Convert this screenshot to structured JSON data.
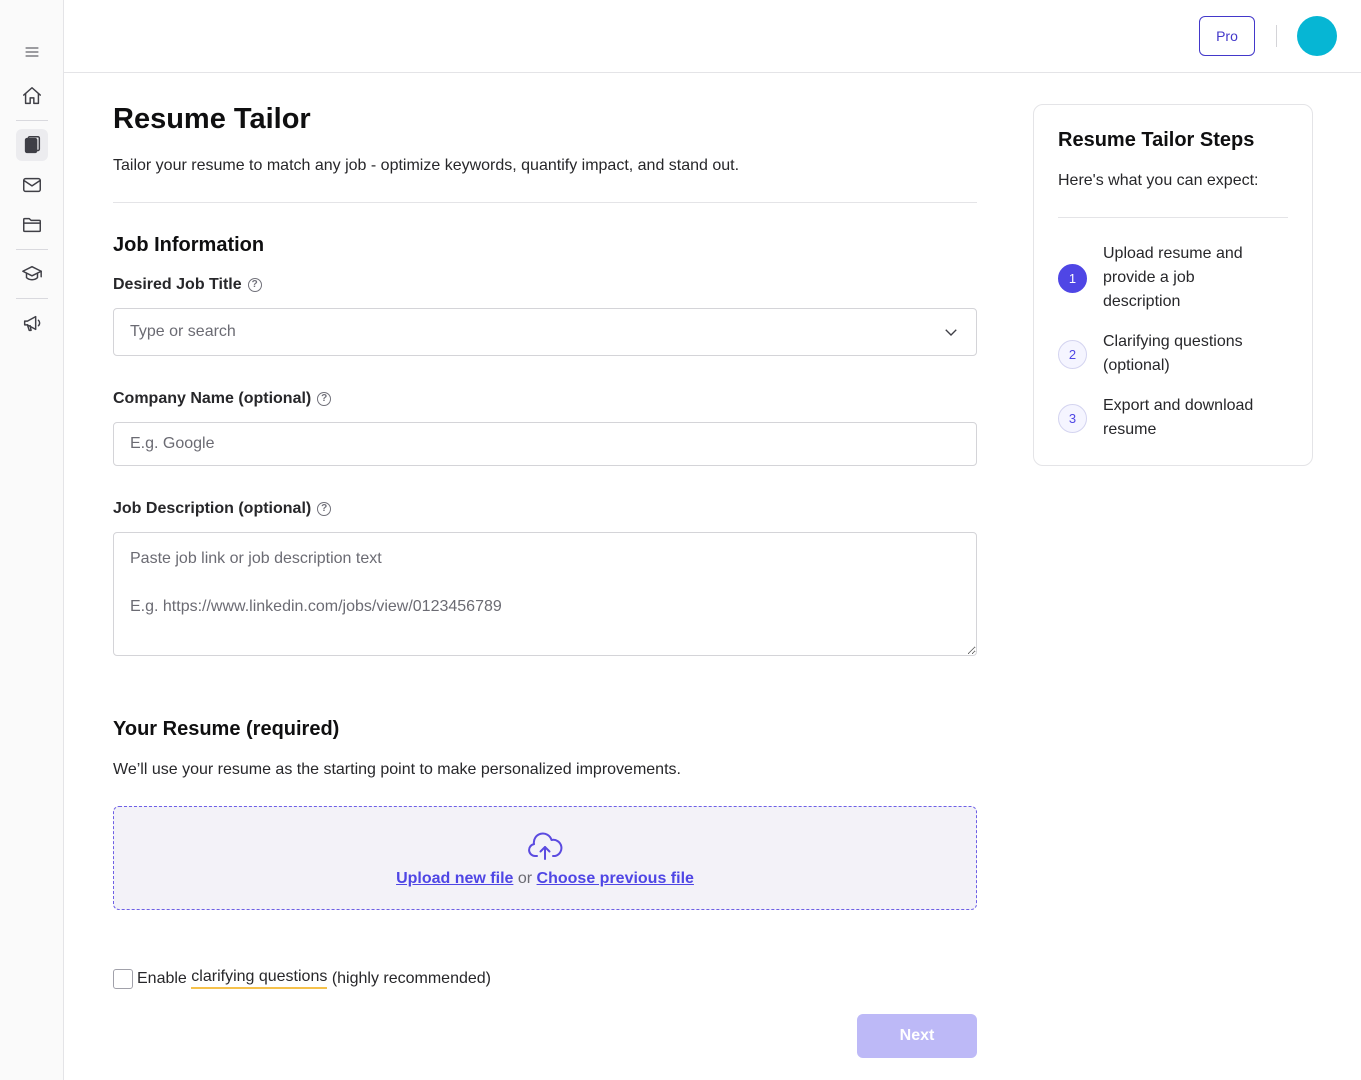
{
  "topbar": {
    "pro_label": "Pro"
  },
  "page": {
    "title": "Resume Tailor",
    "subtitle": "Tailor your resume to match any job - optimize keywords, quantify impact, and stand out."
  },
  "job_info": {
    "title": "Job Information",
    "job_title_label": "Desired Job Title",
    "job_title_placeholder": "Type or search",
    "company_label": "Company Name (optional)",
    "company_placeholder": "E.g. Google",
    "description_label": "Job Description (optional)",
    "description_placeholder": "Paste job link or job description text\n\nE.g. https://www.linkedin.com/jobs/view/0123456789"
  },
  "resume": {
    "title": "Your Resume (required)",
    "subtitle": "We’ll use your resume as the starting point to make personalized improvements.",
    "upload_new": "Upload new file",
    "or": "or",
    "choose_previous": "Choose previous file"
  },
  "clarify": {
    "prefix": "Enable",
    "highlight": "clarifying questions",
    "suffix": "(highly recommended)"
  },
  "next_label": "Next",
  "steps": {
    "title": "Resume Tailor Steps",
    "subtitle": "Here's what you can expect:",
    "items": [
      {
        "num": "1",
        "text": "Upload resume and provide a job description"
      },
      {
        "num": "2",
        "text": "Clarifying questions (optional)"
      },
      {
        "num": "3",
        "text": "Export and download resume"
      }
    ]
  },
  "help_glyph": "?",
  "colors": {
    "accent": "#4f46e5",
    "avatar": "#06b6d4",
    "next_disabled": "#bdb9f7"
  },
  "icons": [
    "menu-icon",
    "home-icon",
    "clipboard-icon",
    "mail-icon",
    "folder-icon",
    "graduation-cap-icon",
    "megaphone-icon",
    "chevron-down-icon",
    "cloud-upload-icon",
    "help-circle-icon"
  ]
}
